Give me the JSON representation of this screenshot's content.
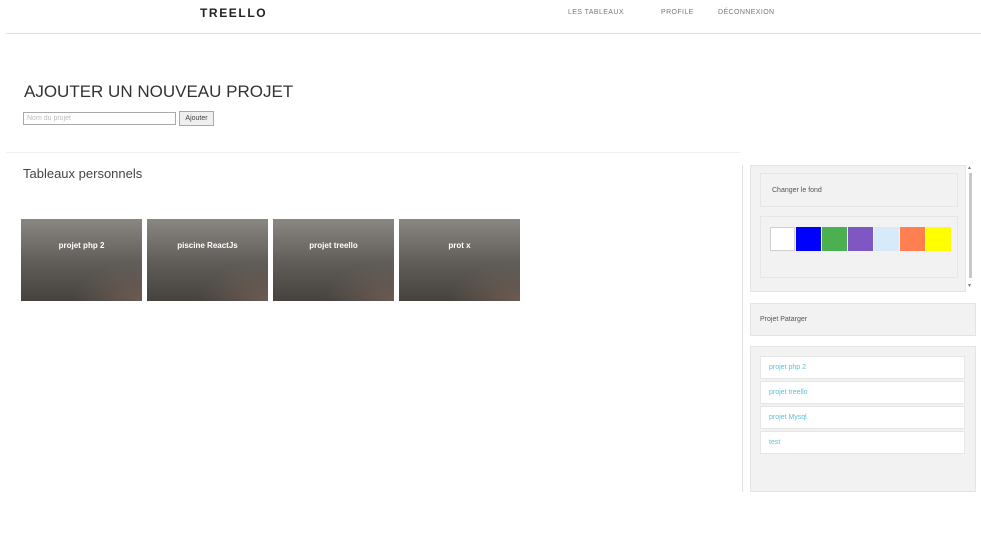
{
  "header": {
    "brand": "TREELLO",
    "nav": [
      "LES TABLEAUX",
      "PROFILE",
      "DÉCONNEXION"
    ]
  },
  "new_project": {
    "title": "AJOUTER UN NOUVEAU PROJET",
    "placeholder": "Nom du projet",
    "button_label": "Ajouter"
  },
  "personal_boards": {
    "title": "Tableaux personnels",
    "boards": [
      "projet php 2",
      "piscine ReactJs",
      "projet treello",
      "prot x"
    ]
  },
  "sidebar": {
    "background_label": "Changer le fond",
    "colors": [
      "#ffffff",
      "#0000ff",
      "#4caf50",
      "#7e57c2",
      "#d6eaf8",
      "#ff7f50",
      "#ffff00"
    ],
    "shared_title": "Projet Patarger",
    "shared_projects": [
      "projet php 2",
      "projet treello",
      "projet Mysql",
      "test"
    ]
  }
}
